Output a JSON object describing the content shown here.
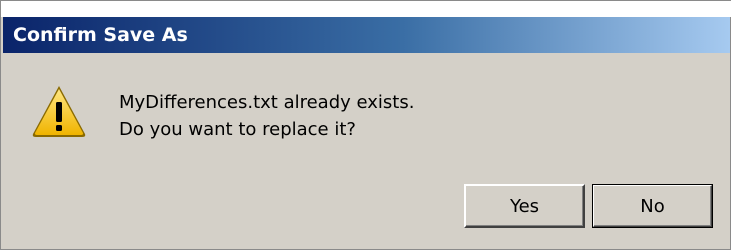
{
  "window": {
    "title": "Confirm Save As"
  },
  "message": {
    "line1": "MyDifferences.txt already exists.",
    "line2": "Do you want to replace it?"
  },
  "icon": {
    "name": "warning-icon",
    "color": "#f5c400"
  },
  "buttons": {
    "yes_label": "Yes",
    "no_label": "No"
  },
  "colors": {
    "title_bar_start": "#0a246a",
    "title_bar_end": "#a6caf0",
    "dialog_background": "#d4d0c8"
  }
}
